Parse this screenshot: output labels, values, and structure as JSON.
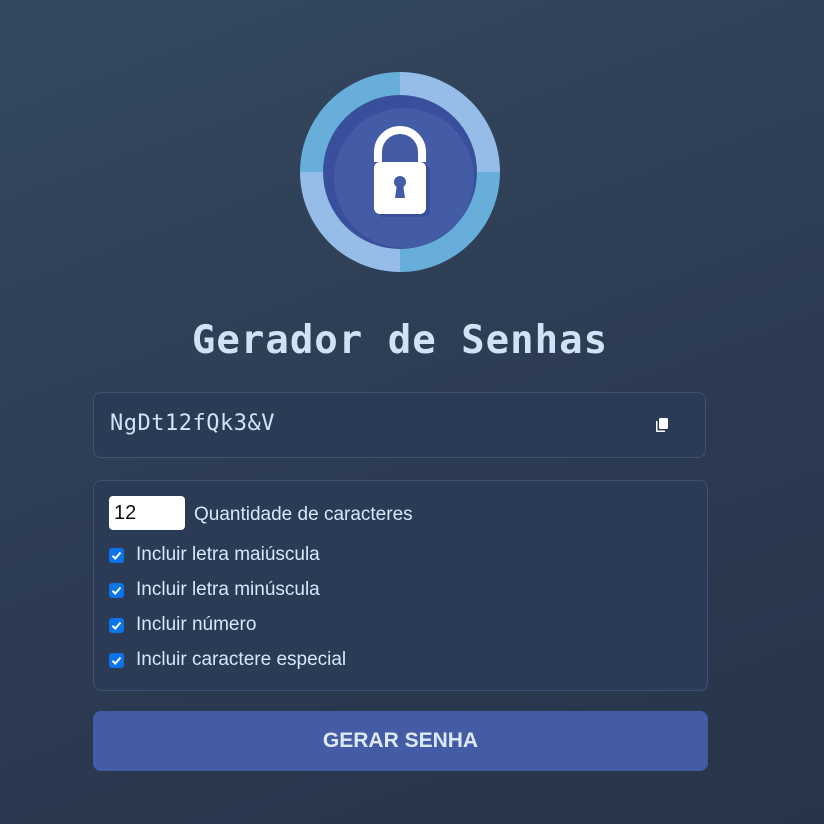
{
  "logo": {
    "icon": "lock-icon",
    "ring_colors": [
      "#67aedb",
      "#95bde8"
    ],
    "inner_color": "#445ca6"
  },
  "title": "Gerador de Senhas",
  "password": {
    "value": "NgDt12fQk3&V",
    "copy_icon": "copy-icon"
  },
  "options": {
    "length_value": "12",
    "length_label": "Quantidade de caracteres",
    "checkboxes": [
      {
        "label": "Incluir letra maiúscula",
        "checked": true
      },
      {
        "label": "Incluir letra minúscula",
        "checked": true
      },
      {
        "label": "Incluir número",
        "checked": true
      },
      {
        "label": "Incluir caractere especial",
        "checked": true
      }
    ]
  },
  "generate_button_label": "GERAR SENHA",
  "colors": {
    "accent": "#445ca6",
    "checkbox": "#0a74e8",
    "text": "#cfe3f7"
  }
}
